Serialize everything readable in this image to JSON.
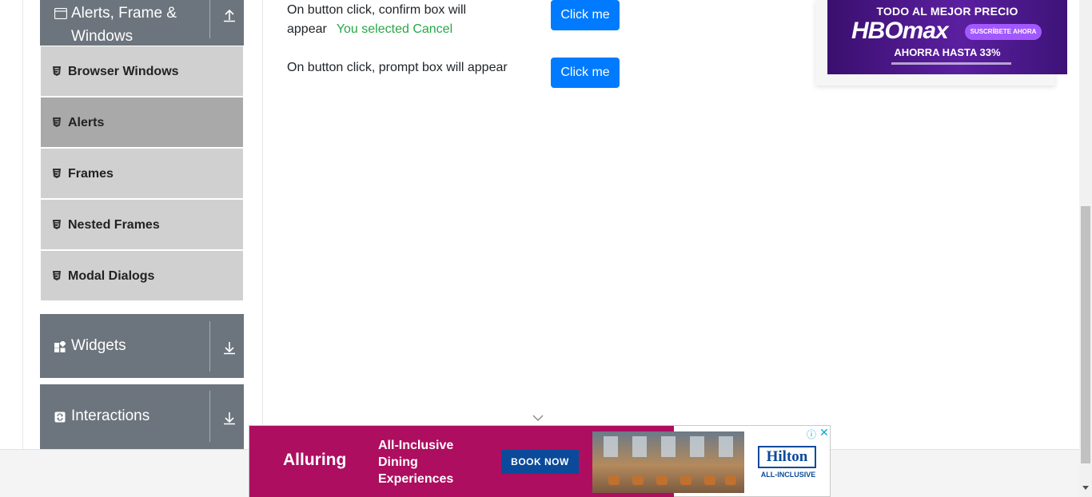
{
  "sidebar": {
    "group_alerts": {
      "title_line1": "Alerts, Frame &",
      "title_line2": "Windows",
      "icon": "window-icon",
      "arrow": "arrow-up-icon"
    },
    "items": [
      {
        "label": "Browser Windows",
        "icon": "html5-icon",
        "active": false
      },
      {
        "label": "Alerts",
        "icon": "html5-icon",
        "active": true
      },
      {
        "label": "Frames",
        "icon": "html5-icon",
        "active": false
      },
      {
        "label": "Nested Frames",
        "icon": "html5-icon",
        "active": false
      },
      {
        "label": "Modal Dialogs",
        "icon": "html5-icon",
        "active": false
      }
    ],
    "group_widgets": {
      "title": "Widgets",
      "icon": "widgets-icon",
      "arrow": "arrow-down-icon"
    },
    "group_interactions": {
      "title": "Interactions",
      "icon": "interactions-icon",
      "arrow": "arrow-down-icon"
    }
  },
  "main": {
    "confirm_text_line1": "On button click, confirm box will",
    "confirm_text_line2": "appear",
    "confirm_result": "You selected Cancel",
    "confirm_button": "Click me",
    "prompt_text": "On button click, prompt box will appear",
    "prompt_button": "Click me"
  },
  "ad_top": {
    "headline": "TODO AL MEJOR PRECIO",
    "brand": "HBOmax",
    "cta": "SUSCRÍBETE AHORA",
    "offer": "AHORRA HASTA 33%"
  },
  "ad_bottom": {
    "headline": "Alluring",
    "line1": "All-Inclusive",
    "line2": "Dining",
    "line3": "Experiences",
    "cta": "BOOK NOW",
    "logo": "Hilton",
    "logo_sub": "ALL-INCLUSIVE",
    "info_glyph": "ⓘ",
    "close_glyph": "✕"
  },
  "colors": {
    "sidebar_group": "#6c757d",
    "menu_item": "#d0d0d0",
    "menu_item_active": "#a9a9a9",
    "primary_button": "#007bff",
    "success_text": "#28a745",
    "ad_magenta": "#ad0e5f",
    "hbo_purple": "#5b1fa0"
  }
}
